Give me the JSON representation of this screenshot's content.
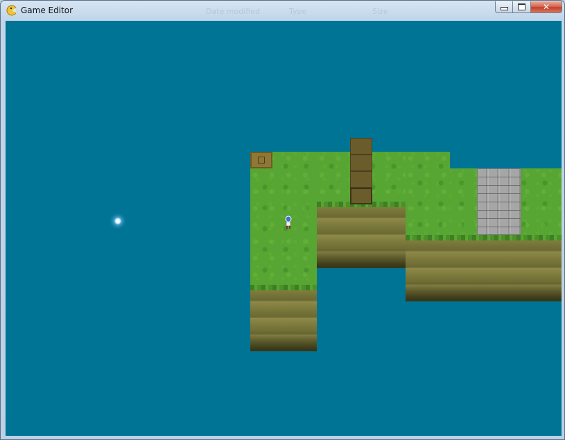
{
  "window": {
    "title": "Game Editor",
    "background_columns": [
      "Date modified",
      "Type",
      "Size"
    ],
    "controls": {
      "minimize": "minimize",
      "maximize": "maximize",
      "close": "✕"
    }
  },
  "icons": {
    "app": "game-editor-app-icon",
    "minimize": "minimize-icon",
    "maximize": "maximize-icon",
    "close": "close-icon"
  },
  "colors": {
    "water": "#007495",
    "grass": "#57a532",
    "cliff": "#7a773b",
    "path": "#6b5c2c",
    "stone": "#a6a6a6"
  },
  "map": {
    "objects": [
      "grass-area",
      "cliff-wall",
      "dirt-path",
      "stone-floor",
      "crate",
      "player-character",
      "light-orb"
    ]
  }
}
